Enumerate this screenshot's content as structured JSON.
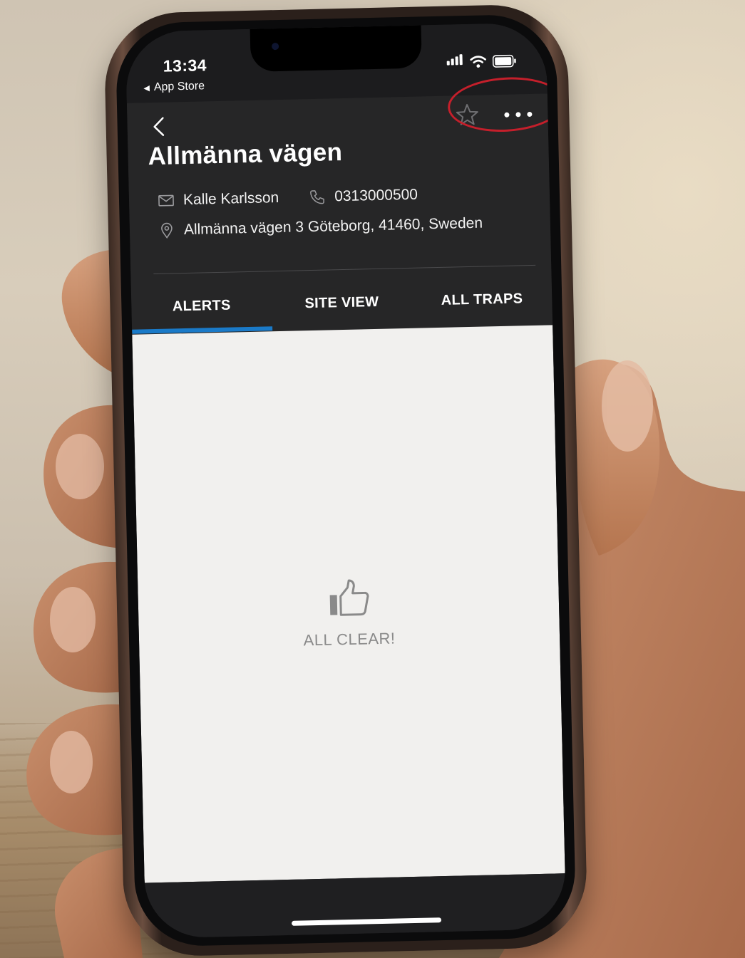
{
  "status_bar": {
    "time": "13:34",
    "back_app_label": "App Store"
  },
  "header": {
    "title": "Allmänna vägen",
    "contact_name": "Kalle Karlsson",
    "phone": "0313000500",
    "address": "Allmänna vägen 3 Göteborg, 41460, Sweden",
    "icons": {
      "back": "chevron-left-icon",
      "favorite": "star-outline-icon",
      "more": "more-horizontal-icon",
      "contact": "mail-icon",
      "phone": "phone-icon",
      "address": "map-pin-icon"
    }
  },
  "tabs": [
    {
      "label": "ALERTS",
      "active": true
    },
    {
      "label": "SITE VIEW",
      "active": false
    },
    {
      "label": "ALL TRAPS",
      "active": false
    }
  ],
  "empty_state": {
    "icon": "thumbs-up-icon",
    "label": "ALL CLEAR!"
  },
  "colors": {
    "header_bg": "#262627",
    "active_tab_indicator": "#1a7ac8",
    "content_bg": "#f1f0ee",
    "highlight_ring": "#c51f2b"
  }
}
